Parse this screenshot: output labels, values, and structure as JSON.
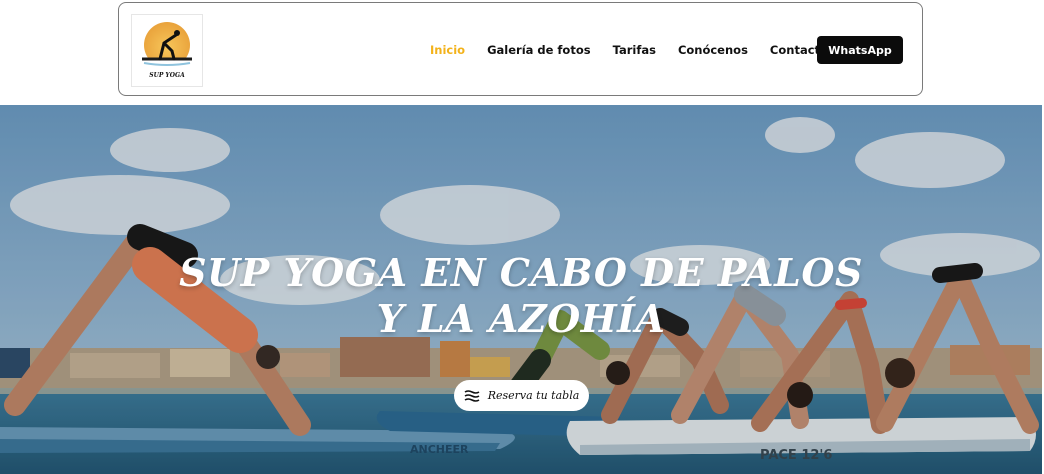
{
  "logo": {
    "text": "SUP YOGA"
  },
  "nav": {
    "items": [
      {
        "label": "Inicio",
        "active": true
      },
      {
        "label": "Galería de fotos",
        "active": false
      },
      {
        "label": "Tarifas",
        "active": false
      },
      {
        "label": "Conócenos",
        "active": false
      },
      {
        "label": "Contacto",
        "active": false
      }
    ],
    "whatsapp_label": "WhatsApp"
  },
  "hero": {
    "title_line1": "SUP YOGA EN CABO DE PALOS",
    "title_line2": "Y LA AZOHÍA",
    "cta_label": "Reserva tu tabla",
    "cta_icon": "waves-icon",
    "board_texts": [
      "ANCHEER",
      "PACE 12'6"
    ]
  },
  "colors": {
    "accent": "#f3b21a",
    "button_bg": "#0b0b0b",
    "sky": "#7fb1d8",
    "sea": "#2f6f8f"
  }
}
